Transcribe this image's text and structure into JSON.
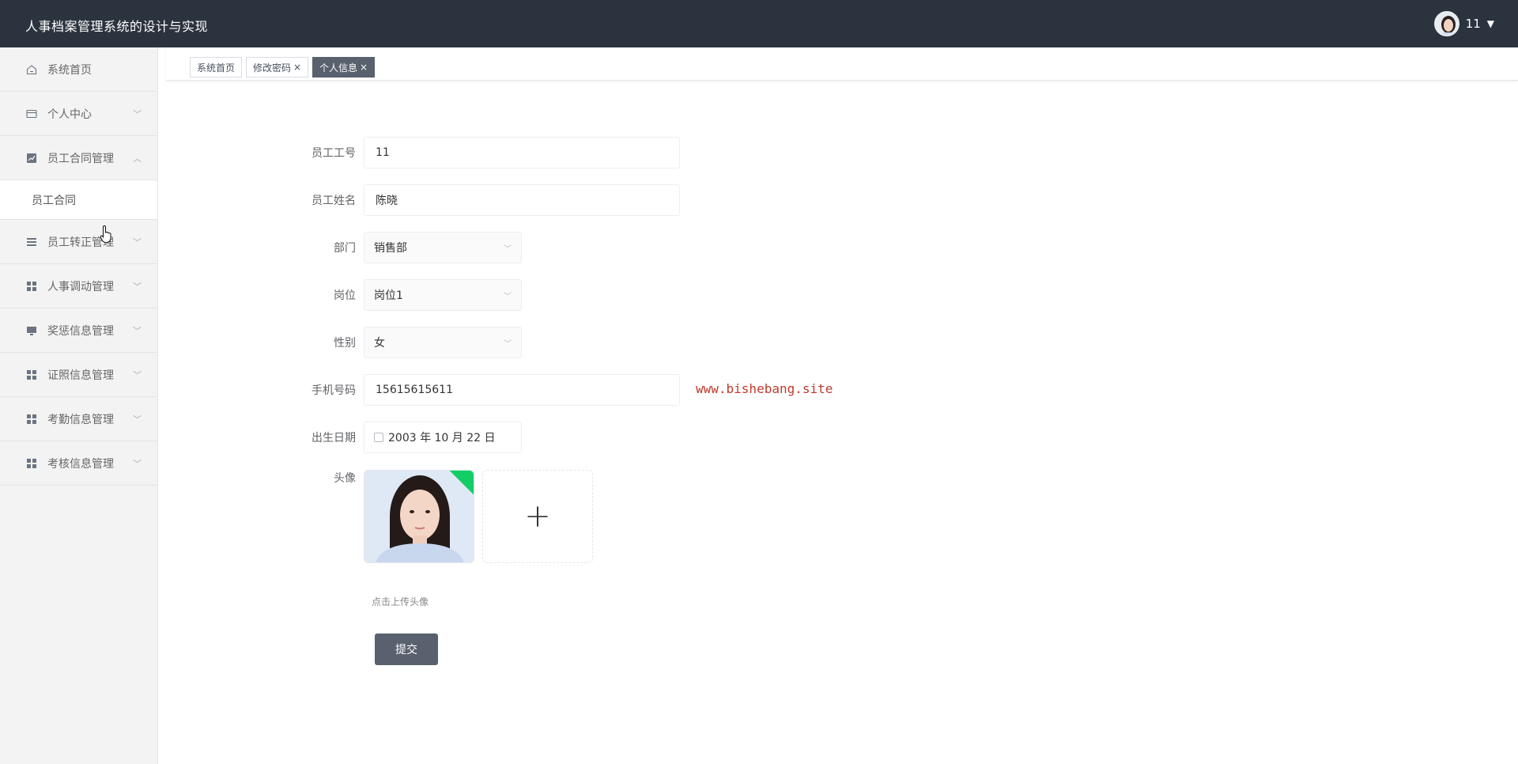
{
  "header": {
    "app_title": "人事档案管理系统的设计与实现",
    "username": "11"
  },
  "sidebar": {
    "items": [
      {
        "label": "系统首页",
        "icon": "home-icon"
      },
      {
        "label": "个人中心",
        "icon": "card-icon"
      },
      {
        "label": "员工合同管理",
        "icon": "chart-icon",
        "expanded": true
      },
      {
        "label": "员工转正管理",
        "icon": "list-icon"
      },
      {
        "label": "人事调动管理",
        "icon": "grid-icon"
      },
      {
        "label": "奖惩信息管理",
        "icon": "monitor-icon"
      },
      {
        "label": "证照信息管理",
        "icon": "grid-icon"
      },
      {
        "label": "考勤信息管理",
        "icon": "grid-icon"
      },
      {
        "label": "考核信息管理",
        "icon": "grid-icon"
      }
    ],
    "submenu": [
      {
        "label": "员工合同"
      }
    ]
  },
  "tabs": [
    {
      "label": "系统首页"
    },
    {
      "label": "修改密码",
      "close": "×"
    },
    {
      "label": "个人信息",
      "close": "×",
      "active": true
    }
  ],
  "form": {
    "employee_id": {
      "label": "员工工号",
      "value": "11"
    },
    "employee_name": {
      "label": "员工姓名",
      "value": "陈晓"
    },
    "department": {
      "label": "部门",
      "value": "销售部"
    },
    "position": {
      "label": "岗位",
      "value": "岗位1"
    },
    "gender": {
      "label": "性别",
      "value": "女"
    },
    "phone": {
      "label": "手机号码",
      "value": "15615615611"
    },
    "birthday": {
      "label": "出生日期",
      "value": "2003 年 10 月 22 日"
    },
    "avatar": {
      "label": "头像",
      "tip": "点击上传头像",
      "plus": "+"
    },
    "submit_label": "提交"
  },
  "watermark": "www.bishebang.site",
  "colors": {
    "header_bg": "#2b333e",
    "accent": "#58616d",
    "upload_success": "#13ce66",
    "watermark": "#c0392b"
  }
}
